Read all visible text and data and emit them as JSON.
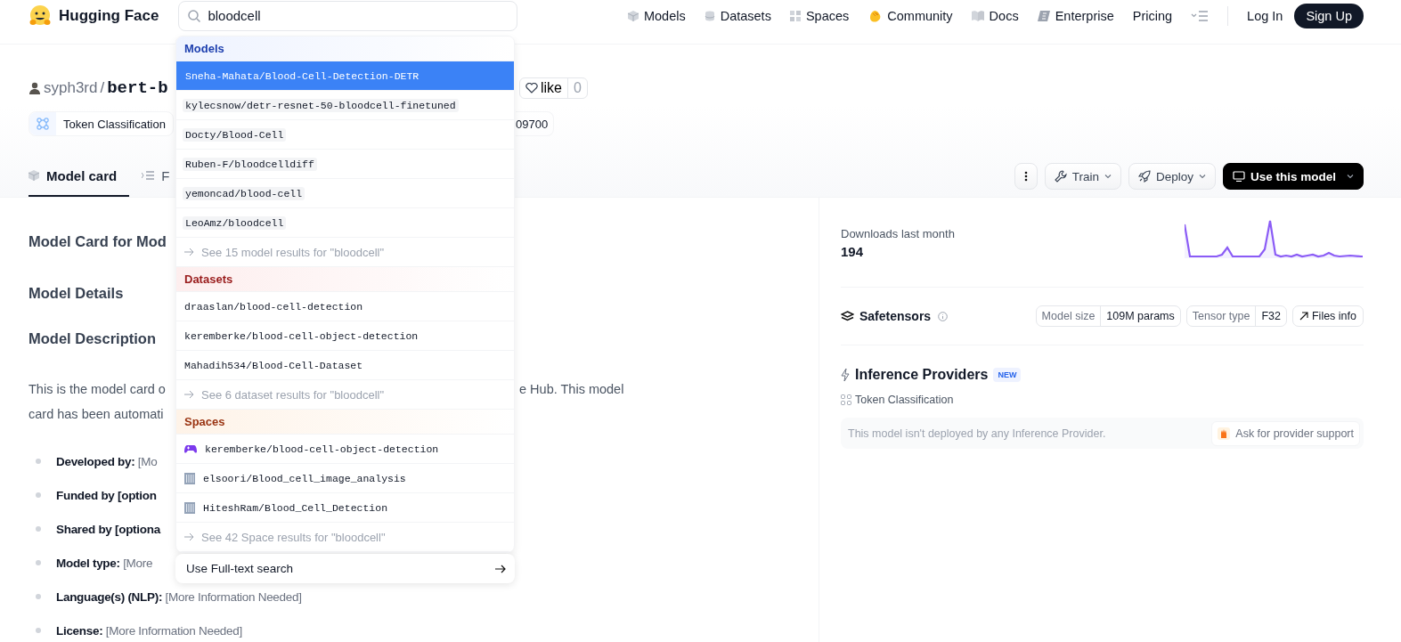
{
  "header": {
    "logo": "Hugging Face",
    "search": {
      "value": "bloodcell"
    },
    "nav": [
      {
        "label": "Models"
      },
      {
        "label": "Datasets"
      },
      {
        "label": "Spaces"
      },
      {
        "label": "Community"
      },
      {
        "label": "Docs"
      },
      {
        "label": "Enterprise"
      },
      {
        "label": "Pricing"
      }
    ],
    "login": "Log In",
    "signup": "Sign Up"
  },
  "model": {
    "owner": "syph3rd",
    "separator": "/",
    "name": "bert-b",
    "like": {
      "label": "like",
      "count": "0"
    },
    "tags": [
      {
        "label": "Token Classification"
      }
    ],
    "tag_cut": "09700",
    "tabs": [
      {
        "label": "Model card",
        "selected": true
      },
      {
        "label": "F",
        "selected": false
      }
    ],
    "actions": {
      "train": "Train",
      "deploy": "Deploy",
      "use": "Use this model"
    }
  },
  "card": {
    "title": "Model Card for Mod",
    "sections": [
      "Model Details",
      "Model Description"
    ],
    "paragraph": [
      {
        "left": "This is the model card o",
        "right": "e Hub. This model"
      },
      {
        "left": "card has been automati"
      }
    ],
    "bullets": [
      {
        "label": "Developed by:",
        "value": "[Mo"
      },
      {
        "label": "Funded by [option"
      },
      {
        "label": "Shared by [optiona"
      },
      {
        "label": "Model type:",
        "value": "[More"
      },
      {
        "label": "Language(s) (NLP):",
        "value": "[More Information Needed]"
      },
      {
        "label": "License:",
        "value": "[More Information Needed]"
      }
    ]
  },
  "sidebar": {
    "downloads_label": "Downloads last month",
    "downloads": "194",
    "safetensors": {
      "title": "Safetensors",
      "stats": [
        {
          "label": "Model size",
          "value": "109M params"
        },
        {
          "label": "Tensor type",
          "value": "F32"
        }
      ],
      "files": "Files info"
    },
    "inference": {
      "title": "Inference Providers",
      "badge": "NEW",
      "task": "Token Classification",
      "message": "This model isn't deployed by any Inference Provider.",
      "ask": "Ask for provider support"
    }
  },
  "dropdown": {
    "sections": [
      {
        "title": "Models",
        "kind": "models",
        "items": [
          {
            "label": "Sneha-Mahata/Blood-Cell-Detection-DETR",
            "selected": true
          },
          {
            "label": "kylecsnow/detr-resnet-50-bloodcell-finetuned",
            "selected": false
          },
          {
            "label": "Docty/Blood-Cell",
            "selected": false
          },
          {
            "label": "Ruben-F/bloodcelldiff",
            "selected": false
          },
          {
            "label": "yemoncad/blood-cell",
            "selected": false
          },
          {
            "label": "LeoAmz/bloodcell",
            "selected": false
          }
        ],
        "more": "See 15 model results for \"bloodcell\""
      },
      {
        "title": "Datasets",
        "kind": "datasets",
        "items": [
          {
            "label": "draaslan/blood-cell-detection",
            "selected": false
          },
          {
            "label": "keremberke/blood-cell-object-detection",
            "selected": false
          },
          {
            "label": "Mahadih534/Blood-Cell-Dataset",
            "selected": false
          }
        ],
        "more": "See 6 dataset results for \"bloodcell\""
      },
      {
        "title": "Spaces",
        "kind": "spaces",
        "items": [
          {
            "label": "keremberke/blood-cell-object-detection",
            "selected": false
          },
          {
            "label": "elsoori/Blood_cell_image_analysis",
            "selected": false
          },
          {
            "label": "HiteshRam/Blood_Cell_Detection",
            "selected": false
          }
        ],
        "more": "See 42 Space results for \"bloodcell\""
      }
    ],
    "fulltext": "Use Full-text search"
  }
}
